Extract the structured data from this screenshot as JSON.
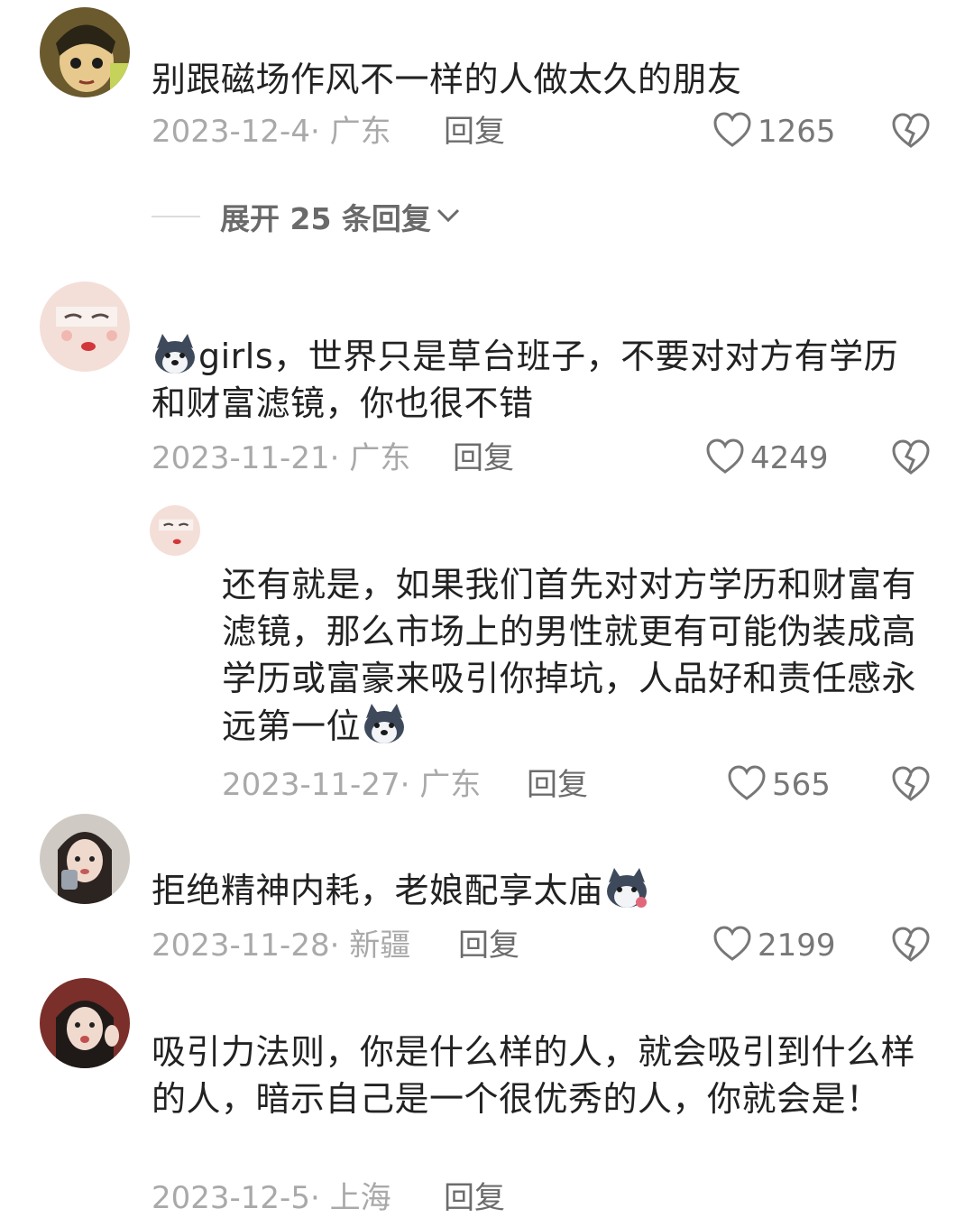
{
  "comments": [
    {
      "text": "别跟磁场作风不一样的人做太久的朋友",
      "meta": "2023-12-4· 广东",
      "reply_label": "回复",
      "likes": "1265"
    },
    {
      "prefix": "girls，",
      "text": "世界只是草台班子，不要对对方有学历和财富滤镜，你也很不错",
      "meta": "2023-11-21· 广东",
      "reply_label": "回复",
      "likes": "4249"
    },
    {
      "text": "拒绝精神内耗，老娘配享太庙",
      "meta": "2023-11-28· 新疆",
      "reply_label": "回复",
      "likes": "2199"
    },
    {
      "text": "吸引力法则，你是什么样的人，就会吸引到什么样的人，暗示自己是一个很优秀的人，你就会是！",
      "meta": "2023-12-5· 上海",
      "reply_label": "回复"
    }
  ],
  "expand_replies": {
    "label": "展开 25 条回复"
  },
  "nested_reply": {
    "text": "还有就是，如果我们首先对对方学历和财富有滤镜，那么市场上的男性就更有可能伪装成高学历或富豪来吸引你掉坑，人品好和责任感永远第一位",
    "meta": "2023-11-27· 广东",
    "reply_label": "回复",
    "likes": "565"
  },
  "icons": {
    "like": "heart-outline-icon",
    "dislike": "broken-heart-icon",
    "expand": "chevron-down-icon",
    "emoji": "husky-dog-emoji"
  },
  "colors": {
    "text": "#222222",
    "meta": "#a9a9a9",
    "reply": "#6c6c6c",
    "icon": "#777777"
  }
}
